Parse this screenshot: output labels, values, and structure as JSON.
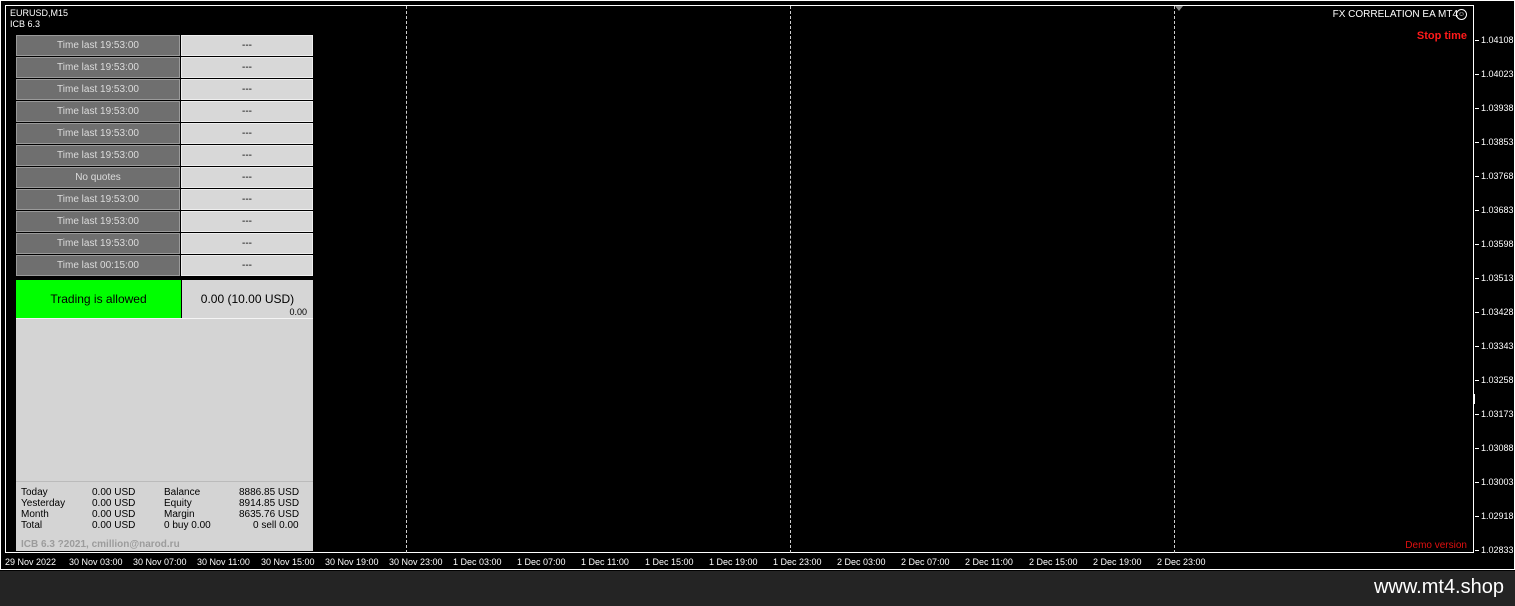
{
  "chart": {
    "symbol": "EURUSD,M15",
    "indicator": "ICB 6.3",
    "ea_title": "FX CORRELATION EA MT4",
    "stop_label": "Stop time",
    "demo_label": "Demo version",
    "price_labels": [
      "1.04108",
      "1.04023",
      "1.03938",
      "1.03853",
      "1.03768",
      "1.03683",
      "1.03598",
      "1.03513",
      "1.03428",
      "1.03343",
      "1.03258",
      "1.03173",
      "1.03088",
      "1.03003",
      "1.02918",
      "1.02833"
    ],
    "time_labels": [
      "29 Nov 2022",
      "30 Nov 03:00",
      "30 Nov 07:00",
      "30 Nov 11:00",
      "30 Nov 15:00",
      "30 Nov 19:00",
      "30 Nov 23:00",
      "1 Dec 03:00",
      "1 Dec 07:00",
      "1 Dec 11:00",
      "1 Dec 15:00",
      "1 Dec 19:00",
      "1 Dec 23:00",
      "2 Dec 03:00",
      "2 Dec 07:00",
      "2 Dec 11:00",
      "2 Dec 15:00",
      "2 Dec 19:00",
      "2 Dec 23:00"
    ]
  },
  "panel": {
    "rows": [
      {
        "left": "Time last 19:53:00",
        "right": "---"
      },
      {
        "left": "Time last 19:53:00",
        "right": "---"
      },
      {
        "left": "Time last 19:53:00",
        "right": "---"
      },
      {
        "left": "Time last 19:53:00",
        "right": "---"
      },
      {
        "left": "Time last 19:53:00",
        "right": "---"
      },
      {
        "left": "Time last 19:53:00",
        "right": "---"
      },
      {
        "left": "No quotes",
        "right": "---"
      },
      {
        "left": "Time last 19:53:00",
        "right": "---"
      },
      {
        "left": "Time last 19:53:00",
        "right": "---"
      },
      {
        "left": "Time last 19:53:00",
        "right": "---"
      },
      {
        "left": "Time last 00:15:00",
        "right": "---"
      }
    ],
    "trading_status": "Trading is allowed",
    "trading_value": "0.00 (10.00 USD)",
    "trading_small": "0.00",
    "stats": {
      "today_label": "Today",
      "today_val": "0.00 USD",
      "yesterday_label": "Yesterday",
      "yesterday_val": "0.00 USD",
      "month_label": "Month",
      "month_val": "0.00 USD",
      "total_label": "Total",
      "total_val": "0.00 USD",
      "balance_label": "Balance",
      "balance_val": "8886.85 USD",
      "equity_label": "Equity",
      "equity_val": "8914.85 USD",
      "margin_label": "Margin",
      "margin_val": "8635.76 USD",
      "buy_label": "0 buy 0.00",
      "sell_label": "0 sell 0.00"
    },
    "copyright": "ICB 6.3 ?2021, cmillion@narod.ru"
  },
  "footer": {
    "site": "www.mt4.shop"
  }
}
